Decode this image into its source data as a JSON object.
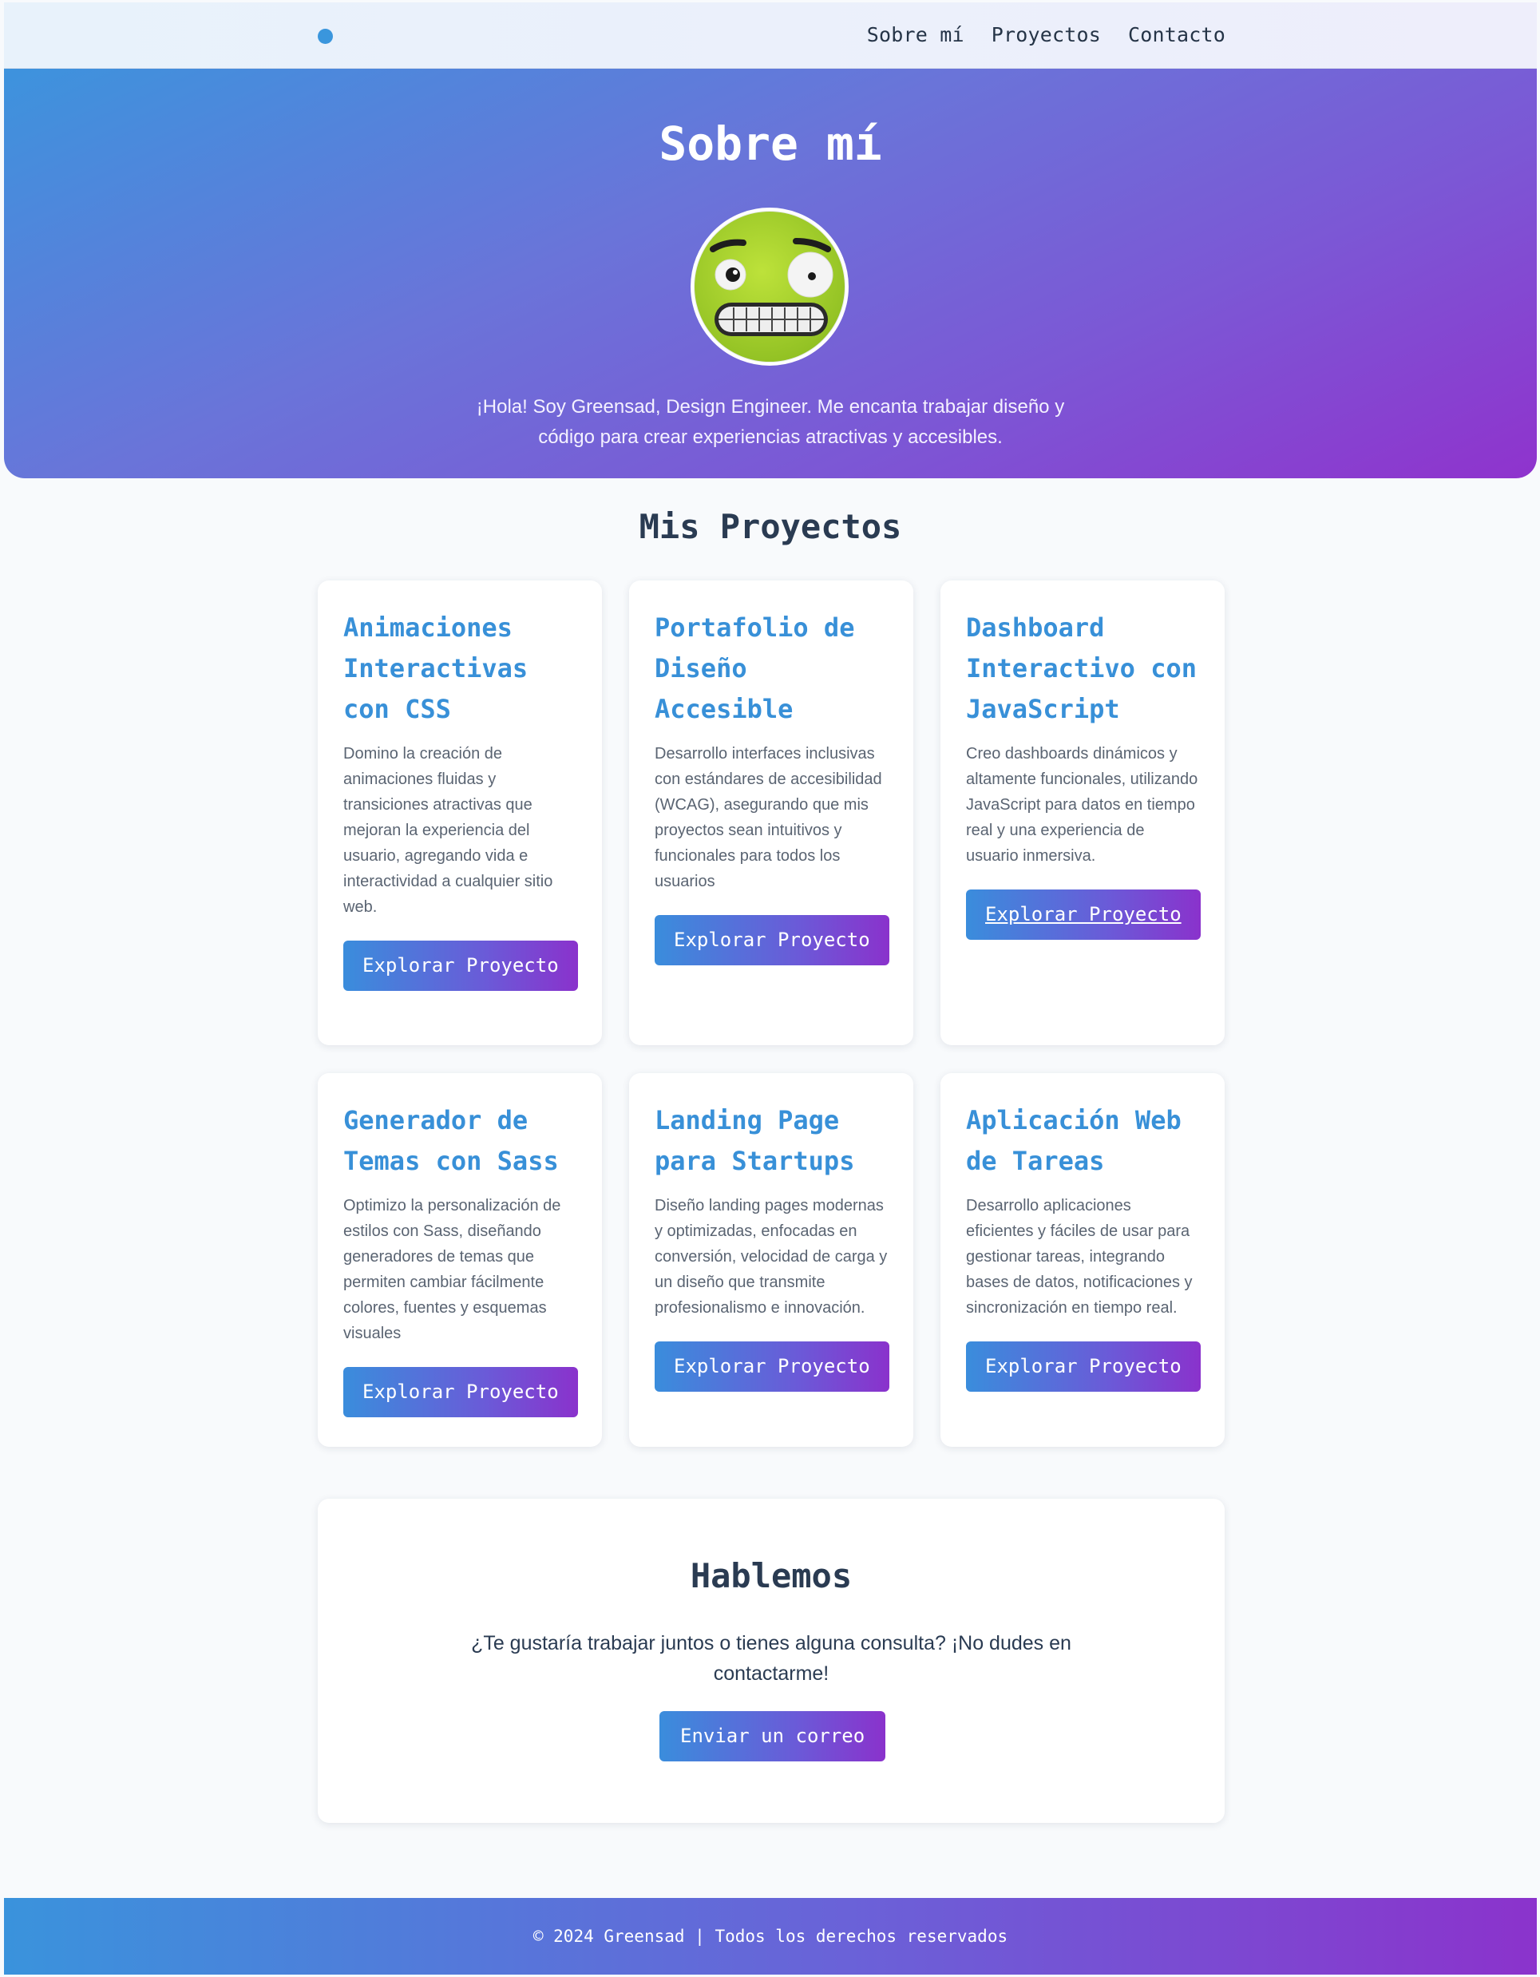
{
  "nav": {
    "links": [
      "Sobre mí",
      "Proyectos",
      "Contacto"
    ]
  },
  "hero": {
    "title": "Sobre mí",
    "intro": "¡Hola! Soy Greensad, Design Engineer. Me encanta trabajar diseño y código para crear experiencias atractivas y accesibles."
  },
  "projects": {
    "title": "Mis Proyectos",
    "items": [
      {
        "title": "Animaciones Interactivas con CSS",
        "description": "Domino la creación de animaciones fluidas y transiciones atractivas que mejoran la experiencia del usuario, agregando vida e interactividad a cualquier sitio web.",
        "button": "Explorar Proyecto"
      },
      {
        "title": "Portafolio de Diseño Accesible",
        "description": "Desarrollo interfaces inclusivas con estándares de accesibilidad (WCAG), asegurando que mis proyectos sean intuitivos y funcionales para todos los usuarios",
        "button": "Explorar Proyecto"
      },
      {
        "title": "Dashboard Interactivo con JavaScript",
        "description": "Creo dashboards dinámicos y altamente funcionales, utilizando JavaScript para datos en tiempo real y una experiencia de usuario inmersiva.",
        "button": "Explorar Proyecto"
      },
      {
        "title": "Generador de Temas con Sass",
        "description": "Optimizo la personalización de estilos con Sass, diseñando generadores de temas que permiten cambiar fácilmente colores, fuentes y esquemas visuales",
        "button": "Explorar Proyecto"
      },
      {
        "title": "Landing Page para Startups",
        "description": "Diseño landing pages modernas y optimizadas, enfocadas en conversión, velocidad de carga y un diseño que transmite profesionalismo e innovación.",
        "button": "Explorar Proyecto"
      },
      {
        "title": "Aplicación Web de Tareas",
        "description": "Desarrollo aplicaciones eficientes y fáciles de usar para gestionar tareas, integrando bases de datos, notificaciones y sincronización en tiempo real.",
        "button": "Explorar Proyecto"
      }
    ]
  },
  "contact": {
    "title": "Hablemos",
    "text": "¿Te gustaría trabajar juntos o tienes alguna consulta? ¡No dudes en contactarme!",
    "button": "Enviar un correo"
  },
  "footer": {
    "text": "© 2024 Greensad | Todos los derechos reservados"
  },
  "icons": {
    "logo": "logo-dot-icon",
    "avatar": "grimacing-face-avatar"
  },
  "colors": {
    "accent": "#3890d8",
    "gradient_start": "#3d93dd",
    "gradient_end": "#8f33cd",
    "avatar_face": "#a8cf2e"
  }
}
